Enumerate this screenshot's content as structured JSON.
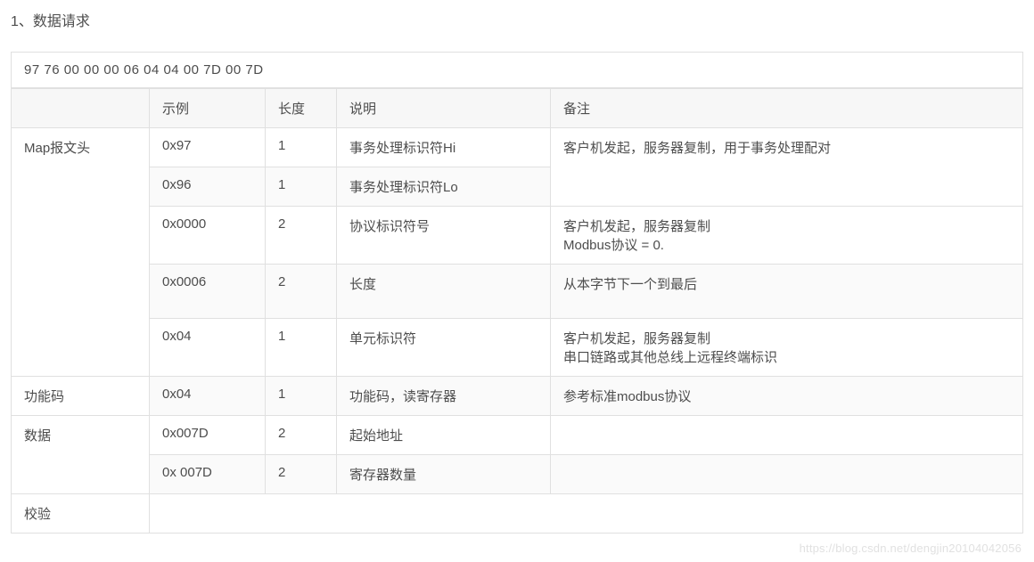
{
  "sectionTitle": "1、数据请求",
  "hexLine": "97 76 00 00 00 06 04 04 00 7D 00 7D",
  "headers": {
    "group": "",
    "example": "示例",
    "length": "长度",
    "desc": "说明",
    "remark": "备注"
  },
  "groups": {
    "mapHeader": "Map报文头",
    "funcCode": "功能码",
    "data": "数据",
    "check": "校验"
  },
  "rows": {
    "r0": {
      "example": "0x97",
      "length": "1",
      "desc": "事务处理标识符Hi",
      "remark": "客户机发起，服务器复制，用于事务处理配对"
    },
    "r1": {
      "example": "0x96",
      "length": "1",
      "desc": "事务处理标识符Lo",
      "remark": ""
    },
    "r2": {
      "example": "0x0000",
      "length": "2",
      "desc": "协议标识符号",
      "remark": "客户机发起，服务器复制\nModbus协议 = 0."
    },
    "r3": {
      "example": "0x0006",
      "length": "2",
      "desc": "长度",
      "remark": "从本字节下一个到最后\n "
    },
    "r4": {
      "example": "0x04",
      "length": "1",
      "desc": "单元标识符",
      "remark": "客户机发起，服务器复制\n串口链路或其他总线上远程终端标识"
    },
    "r5": {
      "example": "0x04",
      "length": "1",
      "desc": "功能码，读寄存器",
      "remark": "参考标准modbus协议"
    },
    "r6": {
      "example": "0x007D",
      "length": "2",
      "desc": "起始地址",
      "remark": ""
    },
    "r7": {
      "example": "0x 007D",
      "length": "2",
      "desc": "寄存器数量",
      "remark": ""
    }
  },
  "watermark": "https://blog.csdn.net/dengjin20104042056"
}
